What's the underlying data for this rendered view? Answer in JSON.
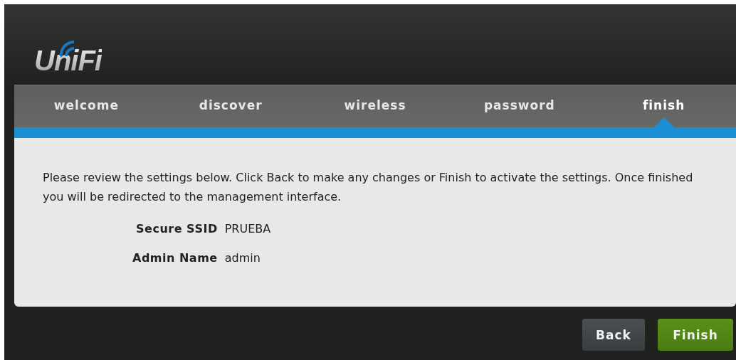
{
  "logo": {
    "text": "UniFi"
  },
  "steps": [
    {
      "label": "welcome",
      "selected": false
    },
    {
      "label": "discover",
      "selected": false
    },
    {
      "label": "wireless",
      "selected": false
    },
    {
      "label": "password",
      "selected": false
    },
    {
      "label": "finish",
      "selected": true
    }
  ],
  "intro": "Please review the settings below. Click Back to make any changes or Finish to activate the settings. Once finished you will be redirected to the management interface.",
  "summary": [
    {
      "label": "Secure SSID",
      "value": "PRUEBA"
    },
    {
      "label": "Admin Name",
      "value": "admin"
    }
  ],
  "buttons": [
    {
      "label": "Back",
      "kind": "secondary"
    },
    {
      "label": "Finish",
      "kind": "primary"
    }
  ]
}
